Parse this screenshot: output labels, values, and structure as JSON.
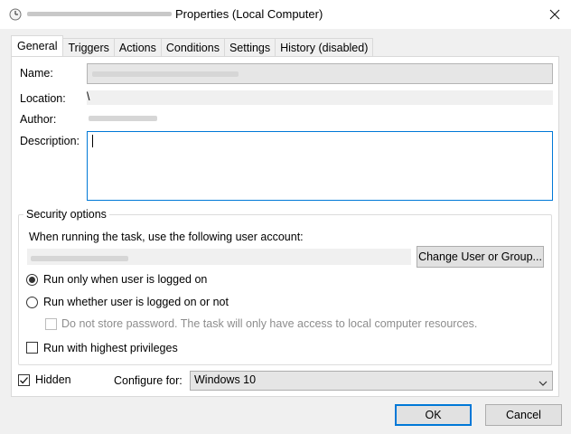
{
  "window": {
    "title": "Properties (Local Computer)",
    "close_icon": "close-icon",
    "app_icon": "clock-icon"
  },
  "tabs": [
    {
      "label": "General",
      "active": true
    },
    {
      "label": "Triggers"
    },
    {
      "label": "Actions"
    },
    {
      "label": "Conditions"
    },
    {
      "label": "Settings"
    },
    {
      "label": "History (disabled)"
    }
  ],
  "general": {
    "name_label": "Name:",
    "location_label": "Location:",
    "location_value": "\\",
    "author_label": "Author:",
    "description_label": "Description:",
    "description_value": ""
  },
  "security": {
    "group_title": "Security options",
    "account_prompt": "When running the task, use the following user account:",
    "change_button": "Change User or Group...",
    "radio_logged_on": {
      "label": "Run only when user is logged on",
      "selected": true
    },
    "radio_whether": {
      "label": "Run whether user is logged on or not",
      "selected": false
    },
    "do_not_store": {
      "label": "Do not store password.  The task will only have access to local computer resources.",
      "checked": false,
      "enabled": false
    },
    "highest_priv": {
      "label": "Run with highest privileges",
      "checked": false
    }
  },
  "bottom": {
    "hidden_label": "Hidden",
    "hidden_checked": true,
    "configure_label": "Configure for:",
    "configure_value": "Windows 10"
  },
  "buttons": {
    "ok": "OK",
    "cancel": "Cancel"
  },
  "colors": {
    "accent": "#0078d7"
  }
}
